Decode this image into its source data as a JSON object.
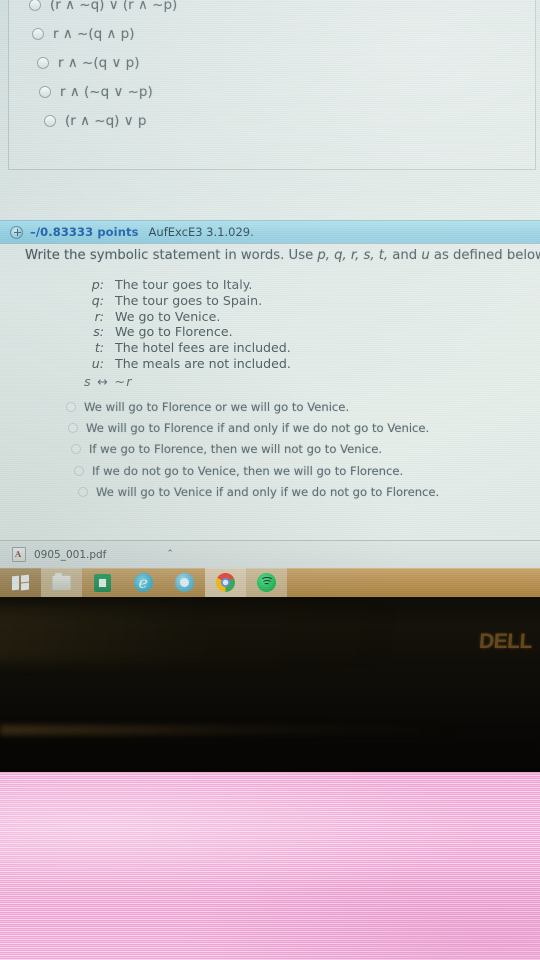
{
  "previous_question": {
    "options": [
      "(r ∧ ~q) ∨ (r ∧ ~p)",
      "r ∧ ~(q ∧ p)",
      "r ∧ ~(q ∨ p)",
      "r ∧ (~q ∨ ~p)",
      "(r ∧ ~q) ∨ p"
    ]
  },
  "question": {
    "points_label": "–/0.83333 points",
    "question_id": "AufExcE3 3.1.029.",
    "expand_icon": "plus-circle-icon",
    "prompt_before": "Write the symbolic statement in words. Use ",
    "prompt_vars": "p, q, r, s, t,",
    "prompt_and": " and ",
    "prompt_var_u": "u",
    "prompt_after": " as defined below.",
    "definitions": [
      {
        "key": "p:",
        "text": "The tour goes to Italy."
      },
      {
        "key": "q:",
        "text": "The tour goes to Spain."
      },
      {
        "key": "r:",
        "text": "We go to Venice."
      },
      {
        "key": "s:",
        "text": "We go to Florence."
      },
      {
        "key": "t:",
        "text": "The hotel fees are included."
      },
      {
        "key": "u:",
        "text": "The meals are not included."
      }
    ],
    "symbolic_statement": "s ↔ ~r",
    "answer_options": [
      "We will go to Florence or we will go to Venice.",
      "We will go to Florence if and only if we do not go to Venice.",
      "If we go to Florence, then we will not go to Venice.",
      "If we do not go to Venice, then we will go to Florence.",
      "We will go to Venice if and only if we do not go to Florence."
    ]
  },
  "download_bar": {
    "file_icon": "pdf-file-icon",
    "file_name": "0905_001.pdf",
    "chevron": "⌃"
  },
  "taskbar": {
    "items": [
      {
        "icon": "windows-start-icon",
        "name": "start-button",
        "state": "start"
      },
      {
        "icon": "file-explorer-icon",
        "name": "taskbar-file-explorer",
        "state": "dim"
      },
      {
        "icon": "excel-icon",
        "name": "taskbar-excel",
        "state": ""
      },
      {
        "icon": "edge-icon",
        "name": "taskbar-edge",
        "state": ""
      },
      {
        "icon": "browser-icon",
        "name": "taskbar-browser",
        "state": ""
      },
      {
        "icon": "chrome-icon",
        "name": "taskbar-chrome",
        "state": "active"
      },
      {
        "icon": "spotify-icon",
        "name": "taskbar-spotify",
        "state": "dim"
      }
    ]
  },
  "monitor": {
    "brand_logo": "DELL"
  },
  "colors": {
    "question_bar": "#92cfe2",
    "points_text": "#1b5fa8",
    "taskbar": "#bb9458",
    "surface": "#f0a8d6",
    "bezel": "#0e0d07"
  }
}
